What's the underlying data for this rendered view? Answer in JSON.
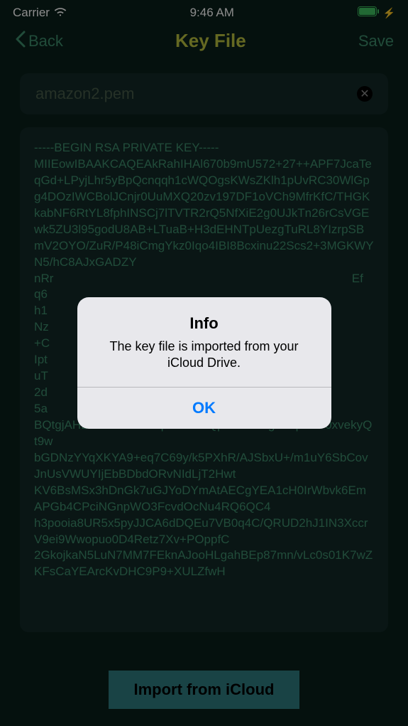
{
  "status_bar": {
    "carrier": "Carrier",
    "time": "9:46 AM"
  },
  "nav": {
    "back_label": "Back",
    "title": "Key File",
    "save_label": "Save"
  },
  "filename": {
    "value": "amazon2.pem"
  },
  "key_content": "-----BEGIN RSA PRIVATE KEY-----\nMIIEowIBAAKCAQEAkRahIHAl670b9mU572+27++APF7JcaTeqGd+LPyjLhr5yBpQcnqqh1cWQOgsKWsZKlh1pUvRC30WlGpg4DOzIWCBolJCnjr0UuMXQ20zv197DF1oVCh9MfrKfC/THGKkabNF6RtYL8fphINSCj7lTVTR2rQ5NfXiE2g0UJkTn26rCsVGEwk5ZU3l95godU8AB+LTuaB+H3dEHNTpUezgTuRL8YIzrpSBmV2OYO/ZuR/P48iCmgYkz0Iqo4IBI8Bcxinu22Scs2+3MGKWYN5/hC8AJxGADZY\nnRr                                                                                         Ef\nq6\nh1\nNz\n+C\nIpt\nuT\n2d\n5a\nBQtgjAHLhw2Wo+tkHPpvw7cezQp/7mRNhguT2p4HT0xvekyQt9w\nbGDNzYYqXKYA9+eq7C69y/k5PXhR/AJSbxU+/m1uY6SbCovJnUsVWUYIjEbBDbdORvNIdLjT2Hwt\nKV6BsMSx3hDnGk7uGJYoDYmAtAECgYEA1cH0IrWbvk6EmAPGb4CPciNGnpWO3FcvdOcNu4RQ6QC4\nh3pooia8UR5x5pyJJCA6dDQEu7VB0q4C/QRUD2hJ1IN3XccrV9ei9Wwopuo0D4Retz7Xv+POppfC\n2GkojkaN5LuN7MM7FEknAJooHLgahBEp87mn/vLc0s01K7wZKFsCaYEArcKvDHC9P9+XULZfwH",
  "import_button": {
    "label": "Import from iCloud"
  },
  "alert": {
    "title": "Info",
    "message": "The key file is imported from your iCloud Drive.",
    "ok_label": "OK"
  }
}
